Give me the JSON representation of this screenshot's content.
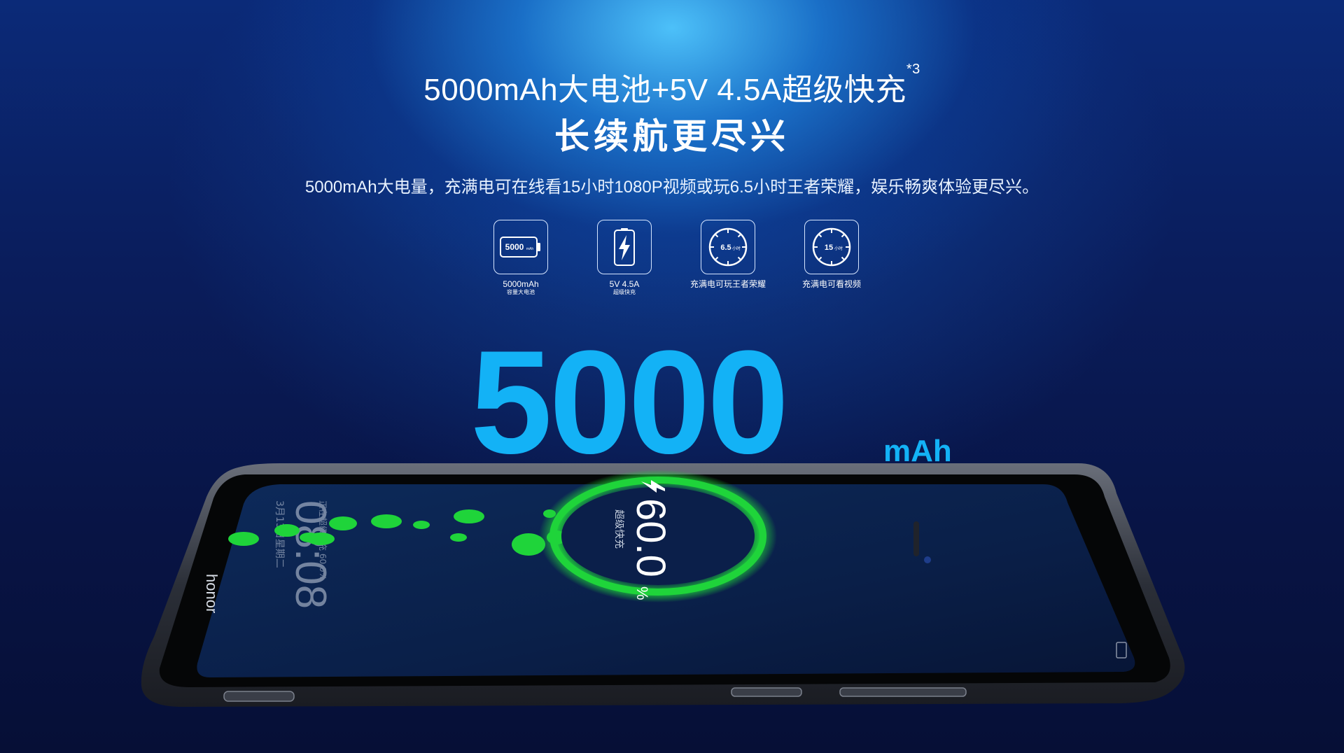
{
  "headline": {
    "text": "5000mAh大电池+5V 4.5A超级快充",
    "footnote": "*3"
  },
  "title": "长续航更尽兴",
  "description": "5000mAh大电量，充满电可在线看15小时1080P视频或玩6.5小时王者荣耀，娱乐畅爽体验更尽兴。",
  "features": [
    {
      "icon": "battery-icon",
      "icon_text": "5000",
      "icon_unit": "mAh",
      "label": "5000mAh",
      "sublabel": "容量大电池"
    },
    {
      "icon": "lightning-icon",
      "label": "5V 4.5A",
      "sublabel": "超级快充"
    },
    {
      "icon": "clock-icon",
      "icon_text": "6.5",
      "icon_unit": "小时",
      "label": "充满电可玩王者荣耀",
      "sublabel": ""
    },
    {
      "icon": "clock-icon",
      "icon_text": "15",
      "icon_unit": "小时",
      "label": "充满电可看视频",
      "sublabel": ""
    }
  ],
  "capacity": {
    "number": "5000",
    "unit": "mAh"
  },
  "phone": {
    "brand": "honor",
    "clock": "08:08",
    "date": "3月13日星期二",
    "charging_status": "正在超级快充 60.0%",
    "charge_percent": "60.0",
    "percent_sign": "%",
    "charge_mode": "超级快充"
  },
  "colors": {
    "accent_blue": "#13b2f6",
    "charge_green": "#1fd43a",
    "background_dark": "#07103a"
  }
}
